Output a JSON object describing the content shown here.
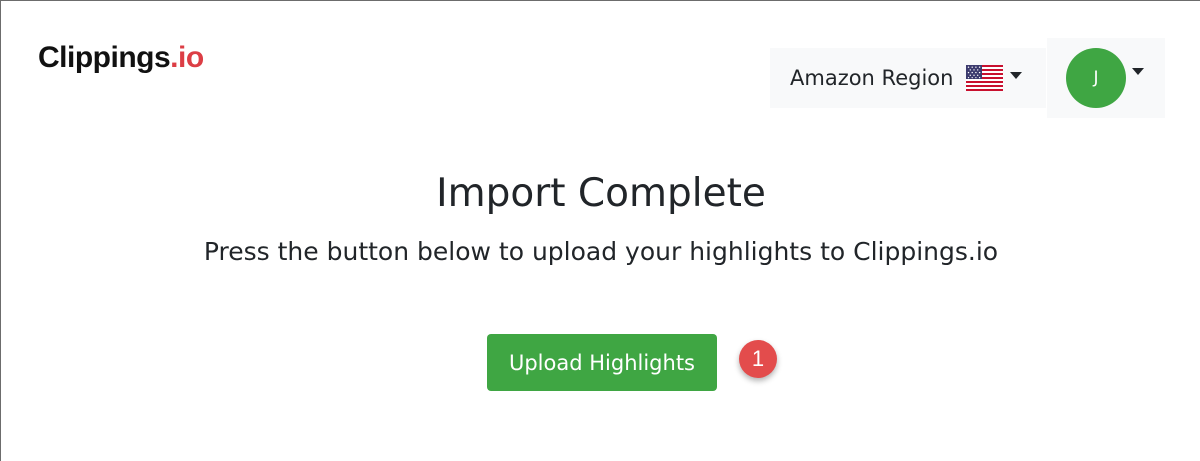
{
  "header": {
    "logo": {
      "name": "Clippings",
      "suffix": ".io",
      "suffix_color": "#dc3e45"
    },
    "region_dropdown": {
      "label": "Amazon Region",
      "flag_icon": "us-flag-icon"
    },
    "user_menu": {
      "avatar_initial": "J",
      "avatar_color": "#3fa643"
    }
  },
  "main": {
    "title": "Import Complete",
    "subtitle": "Press the button below to upload your highlights to Clippings.io",
    "upload_button_label": "Upload Highlights",
    "button_color": "#3fa643",
    "step_badge": "1",
    "step_badge_color": "#e34c4c"
  }
}
